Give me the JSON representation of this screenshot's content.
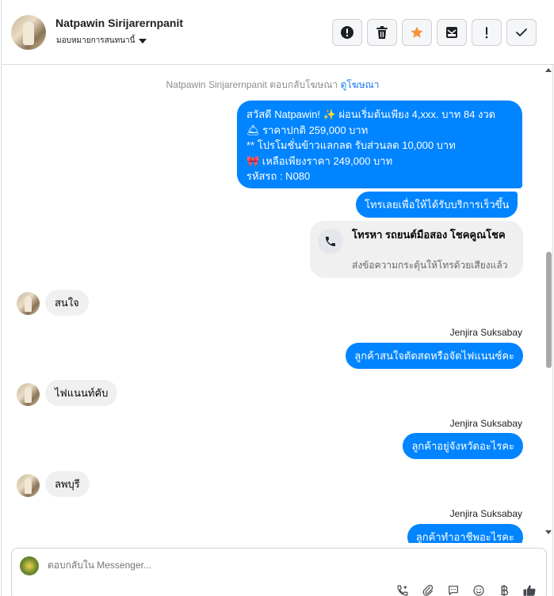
{
  "header": {
    "name": "Natpawin Sirijarernpanit",
    "assign_label": "มอบหมายการสนทนานี้"
  },
  "toolbar": {
    "buttons": [
      {
        "icon": "alert-circle-icon"
      },
      {
        "icon": "trash-icon"
      },
      {
        "icon": "star-icon",
        "color": "#f7923a"
      },
      {
        "icon": "mark-unread-icon"
      },
      {
        "icon": "exclamation-icon"
      },
      {
        "icon": "check-icon"
      }
    ]
  },
  "conversation": {
    "notice_prefix": "Natpawin Sirijarernpanit ตอบกลับโฆษณา",
    "notice_link": "ดูโฆษณา",
    "ad_message": {
      "lines": [
        "สวัสดี Natpawin! ✨  ผ่อนเริ่มต้นเพียง 4,xxx. บาท 84 งวด",
        "🛎 ราคาปกติ 259,000 บาท",
        "** โปรโมชั่นข้าวแลกลด รับส่วนลด 10,000 บาท",
        "🎀  เหลือเพียงราคา 249,000 บาท",
        " รหัสรถ : N080"
      ]
    },
    "cta_message": "โทรเลยเพื่อให้ได้รับบริการเร็วขึ้น",
    "call_card": {
      "title": "โทรหา รถยนต์มือสอง โชคคูณโชค",
      "subtitle": "ส่งข้อความกระตุ้นให้โทรด้วยเสียงแล้ว"
    },
    "messages": [
      {
        "dir": "in",
        "text": "สนใจ"
      },
      {
        "dir": "out",
        "sender": "Jenjira Suksabay",
        "text": "ลูกค้าสนใจตัดสดหรือจัดไฟแนนซ์คะ"
      },
      {
        "dir": "in",
        "text": "ไฟแนนท์คับ"
      },
      {
        "dir": "out",
        "sender": "Jenjira Suksabay",
        "text": "ลูกค้าอยู่จังหวัดอะไรคะ"
      },
      {
        "dir": "in",
        "text": "ลพบุรี"
      },
      {
        "dir": "out",
        "sender": "Jenjira Suksabay",
        "text": "ลูกค้าทำอาชีพอะไรคะ"
      }
    ]
  },
  "composer": {
    "placeholder": "ตอบกลับใน Messenger...",
    "tools": [
      "call-add-icon",
      "attachment-icon",
      "saved-reply-icon",
      "emoji-icon",
      "baht-icon",
      "thumbs-up-icon"
    ]
  }
}
